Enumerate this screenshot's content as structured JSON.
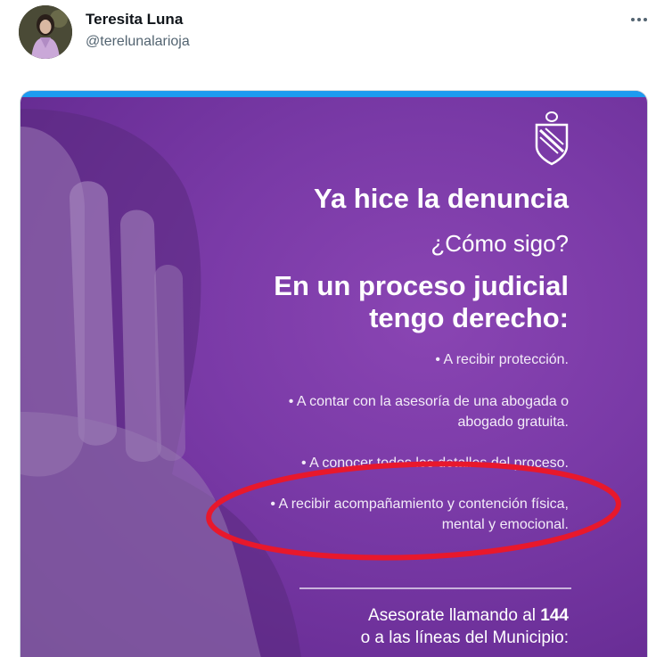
{
  "user": {
    "name": "Teresita Luna",
    "handle": "@terelunalarioja"
  },
  "poster": {
    "title": "Ya hice la denuncia",
    "subtitle": "¿Cómo sigo?",
    "heading_line1": "En un proceso judicial",
    "heading_line2": "tengo derecho:",
    "rights": [
      {
        "line1": "• A recibir protección."
      },
      {
        "line1": "• A contar con la asesoría de una abogada o",
        "line2": "abogado gratuita."
      },
      {
        "line1": "• A conocer todos los detalles del proceso."
      },
      {
        "line1": "• A recibir acompañamiento y contención física,",
        "line2": "mental y emocional."
      }
    ],
    "cta_line1_prefix": "Asesorate llamando al",
    "cta_number": "144",
    "cta_line2": "o a las líneas del Municipio:",
    "colors": {
      "background": "#7a3aa7",
      "highlight_ellipse": "#e8182c",
      "media_top_bar": "#1d9bf0"
    }
  },
  "icons": {
    "more": "more-horizontal-icon",
    "crest": "municipal-crest-icon"
  }
}
